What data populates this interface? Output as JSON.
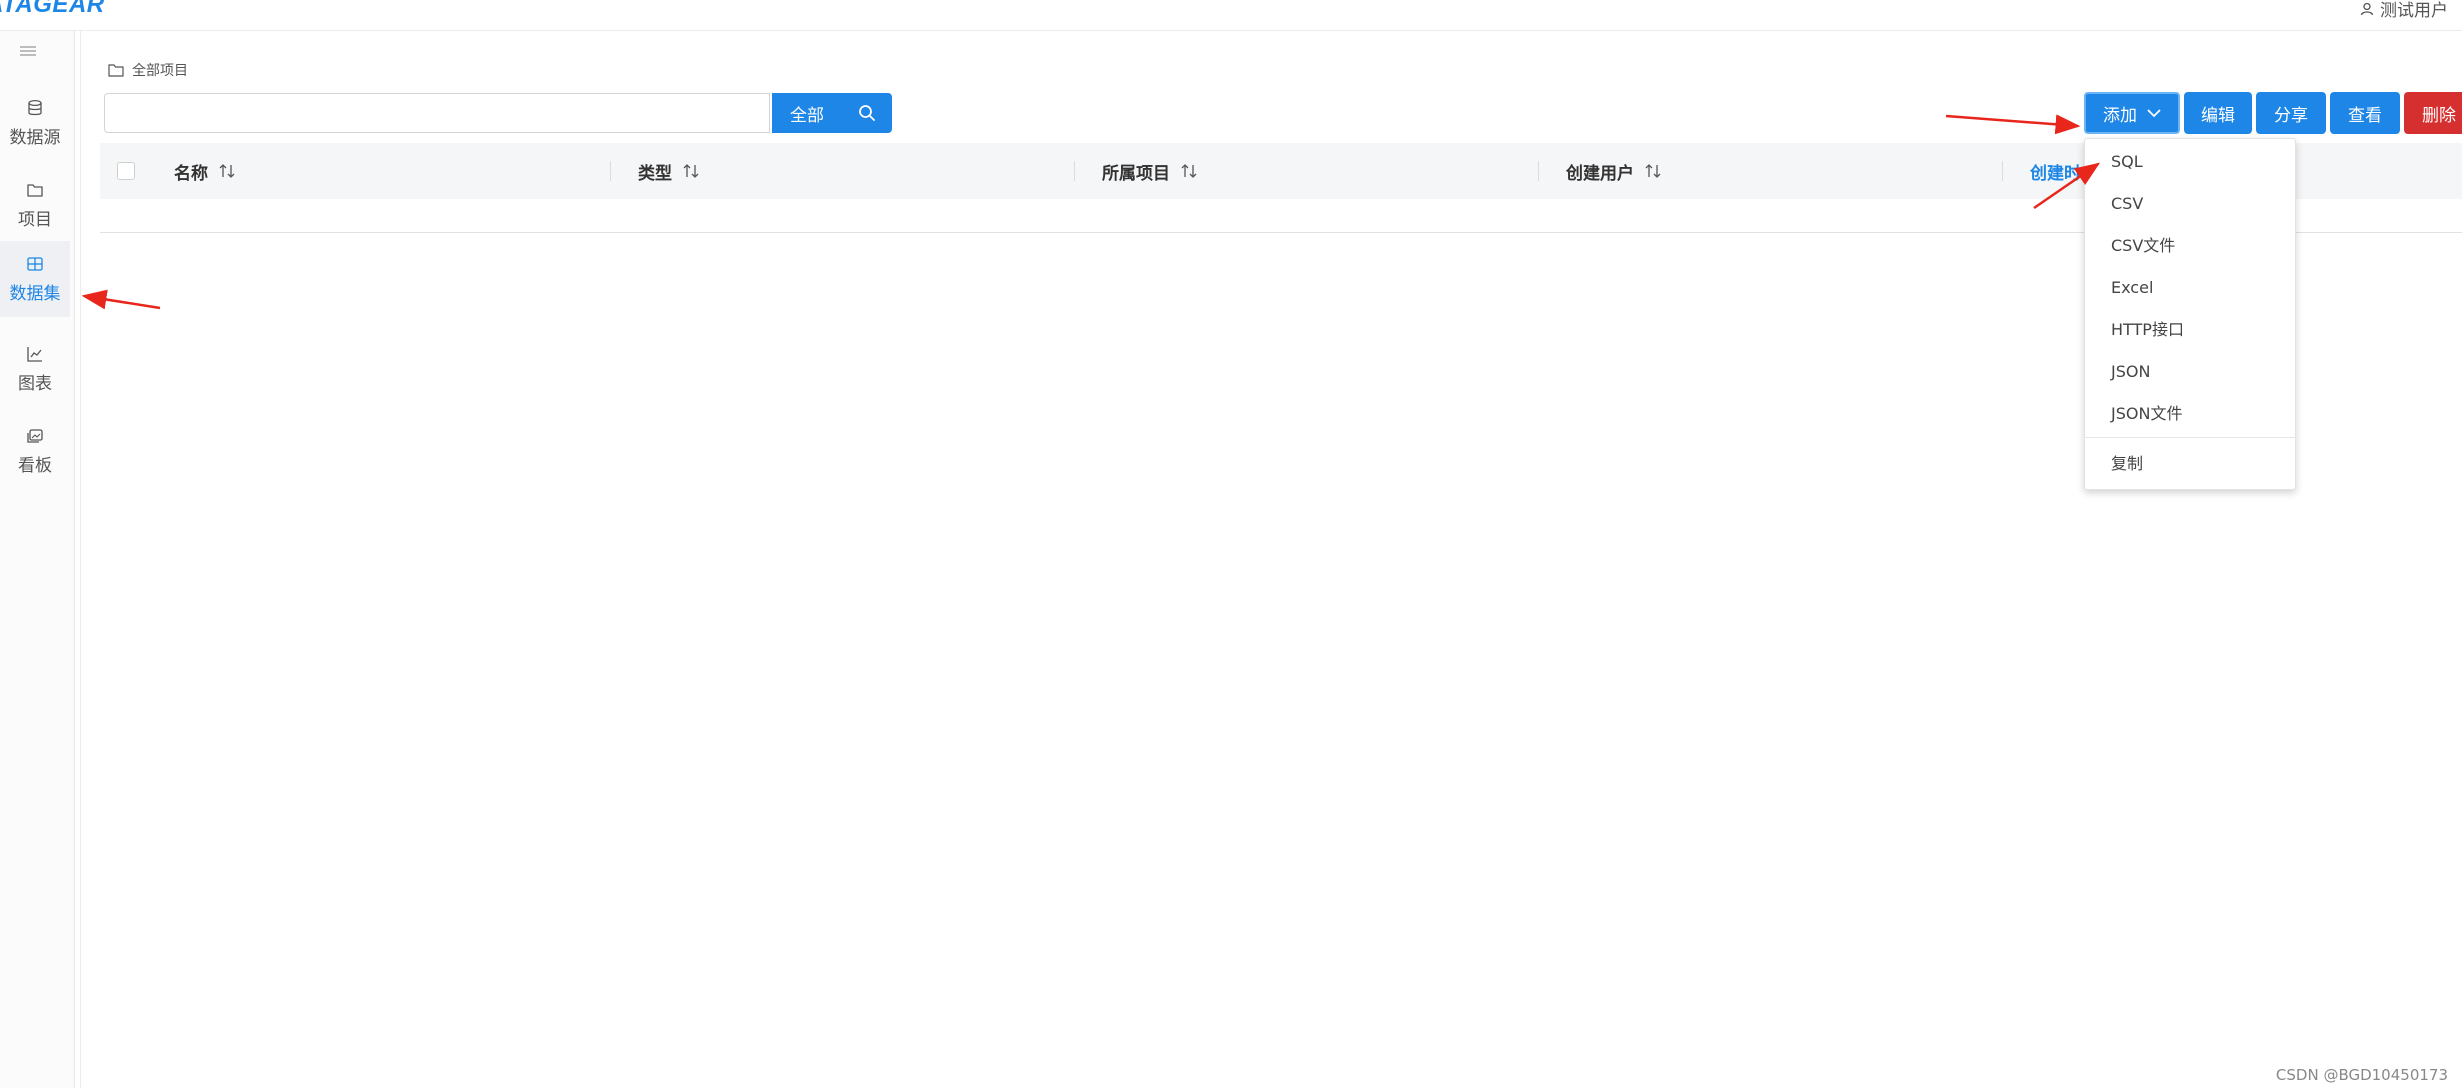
{
  "header": {
    "logo": "ATAGEAR",
    "user": "测试用户"
  },
  "sidebar": {
    "items": [
      {
        "label": "数据源",
        "icon": "database-icon"
      },
      {
        "label": "项目",
        "icon": "folder-icon"
      },
      {
        "label": "数据集",
        "icon": "table-grid-icon",
        "active": true
      },
      {
        "label": "图表",
        "icon": "line-chart-icon"
      },
      {
        "label": "看板",
        "icon": "image-board-icon"
      }
    ]
  },
  "breadcrumb": {
    "label": "全部项目"
  },
  "search": {
    "value": "",
    "scope_label": "全部"
  },
  "toolbar": {
    "add_label": "添加",
    "edit_label": "编辑",
    "share_label": "分享",
    "view_label": "查看",
    "delete_label": "删除"
  },
  "table": {
    "columns": [
      "名称",
      "类型",
      "所属项目",
      "创建用户",
      "创建时"
    ]
  },
  "add_menu": {
    "items": [
      "SQL",
      "CSV",
      "CSV文件",
      "Excel",
      "HTTP接口",
      "JSON",
      "JSON文件"
    ],
    "copy_label": "复制"
  },
  "watermark": "CSDN @BGD10450173",
  "colors": {
    "primary": "#1d86e6",
    "danger": "#d62f2f",
    "annotation_arrow": "#e8261c"
  }
}
